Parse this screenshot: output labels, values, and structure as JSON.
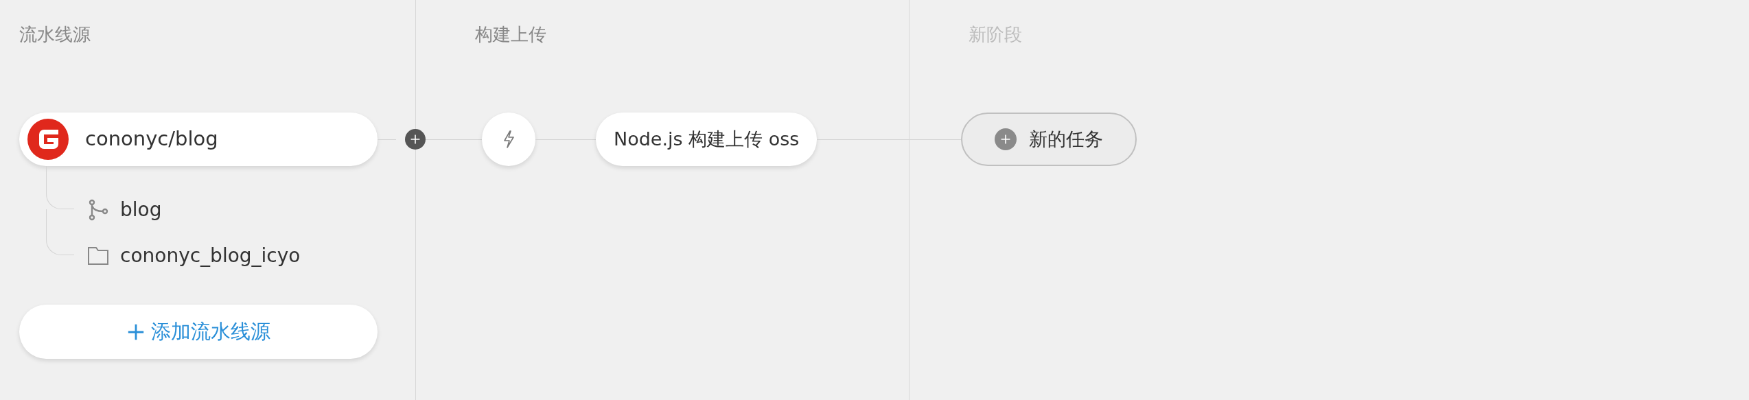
{
  "stages": [
    {
      "title": "流水线源",
      "kind": "source",
      "sources": [
        {
          "name": "cononyc/blog",
          "children": [
            {
              "kind": "branch",
              "label": "blog"
            },
            {
              "kind": "folder",
              "label": "cononyc_blog_icyo"
            }
          ]
        }
      ],
      "add_button": "添加流水线源"
    },
    {
      "title": "构建上传",
      "kind": "build",
      "tasks": [
        {
          "kind": "trigger"
        },
        {
          "kind": "task",
          "label": "Node.js 构建上传 oss"
        }
      ]
    },
    {
      "title": "新阶段",
      "kind": "new",
      "tasks": [
        {
          "kind": "new_task",
          "label": "新的任务"
        }
      ]
    }
  ]
}
